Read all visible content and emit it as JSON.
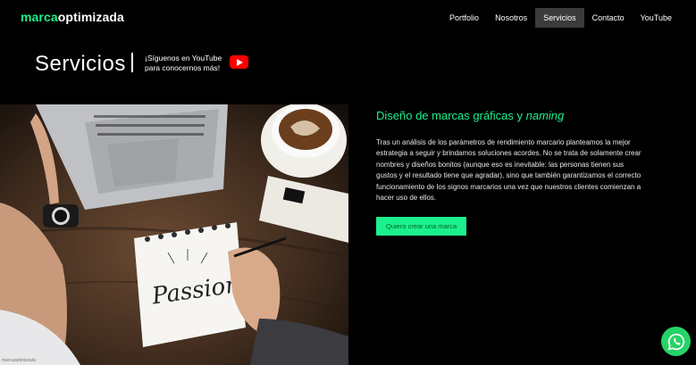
{
  "header": {
    "logo_brand": "marca",
    "logo_rest": "optimizada",
    "nav": [
      {
        "label": "Portfolio",
        "active": false
      },
      {
        "label": "Nosotros",
        "active": false
      },
      {
        "label": "Servicios",
        "active": true
      },
      {
        "label": "Contacto",
        "active": false
      },
      {
        "label": "YouTube",
        "active": false
      }
    ]
  },
  "hero": {
    "title": "Servicios",
    "youtube_line1": "¡Síguenos en YouTube",
    "youtube_line2": "para conocernos más!"
  },
  "service": {
    "heading_main": "Diseño de marcas gráficas y ",
    "heading_em": "naming",
    "body": "Tras un análisis de los parámetros de rendimiento marcario planteamos la mejor estrategia a seguir y brindamos soluciones acordes. No se trata de solamente crear nombres y diseños bonitos (aunque eso es inevitable: las personas tienen sus gustos y el resultado tiene que agradar), sino que también garantizamos el correcto funcionamiento de los signos marcarios una vez que nuestros clientes comienzan a hacer uso de ellos.",
    "cta_label": "Quiero crear una marca"
  },
  "photo": {
    "sketch_text": "Passion",
    "credit": "marcaoptimizada"
  },
  "colors": {
    "accent": "#1cf08c",
    "nav_active_bg": "#3b3b3b",
    "youtube_red": "#ff0000",
    "whatsapp": "#25d366"
  },
  "icons": {
    "youtube": "youtube-icon",
    "whatsapp": "whatsapp-icon"
  }
}
